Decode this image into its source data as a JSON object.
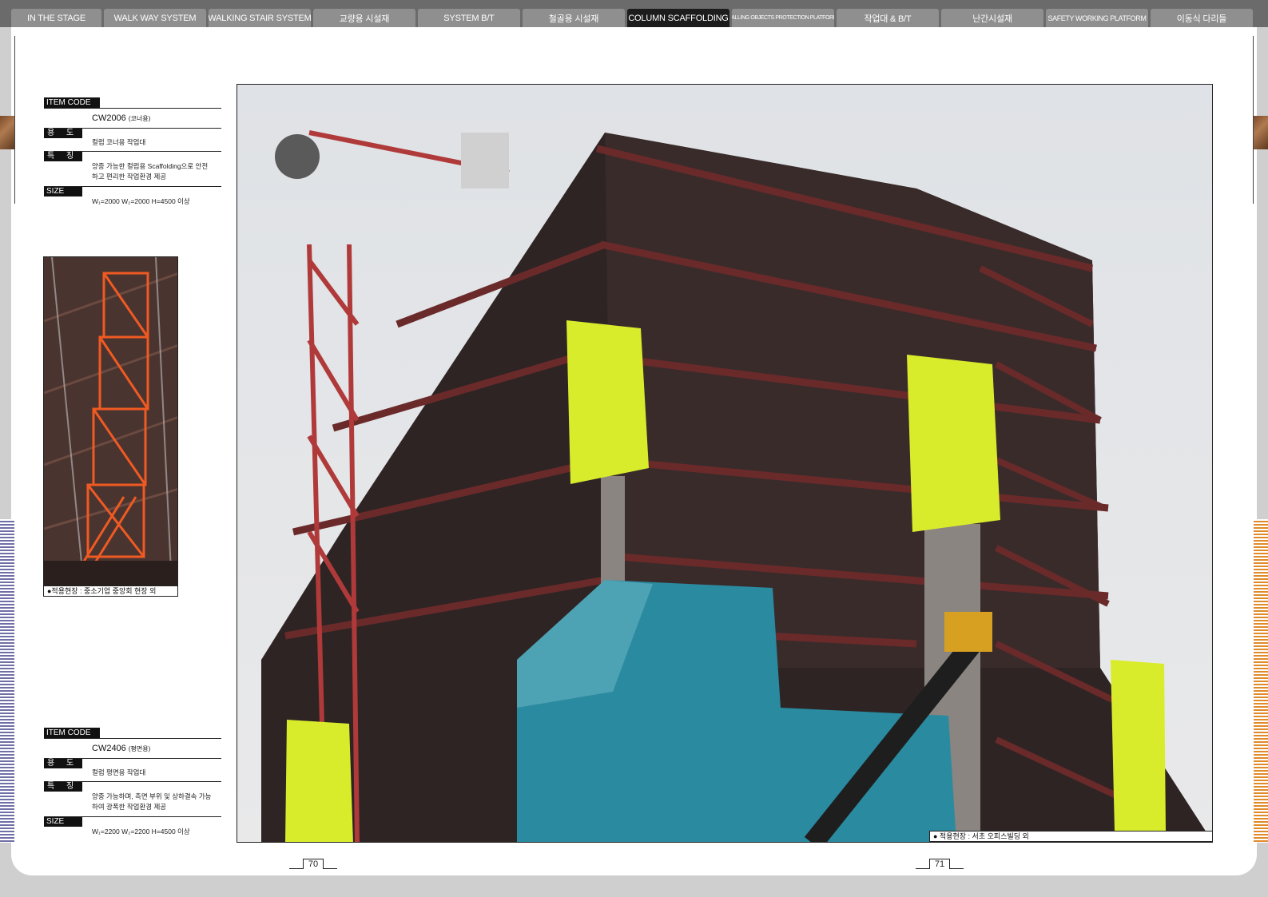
{
  "nav": {
    "tabs": [
      {
        "label": "IN THE STAGE",
        "active": false
      },
      {
        "label": "WALK WAY SYSTEM",
        "active": false
      },
      {
        "label": "WALKING STAIR SYSTEM",
        "active": false
      },
      {
        "label": "교량용 시설재",
        "active": false
      },
      {
        "label": "SYSTEM B/T",
        "active": false
      },
      {
        "label": "철골용 시설재",
        "active": false
      },
      {
        "label": "COLUMN SCAFFOLDING",
        "active": true
      },
      {
        "label": "FALLING OBJECTS PROTECTION PLATFORM",
        "active": false
      },
      {
        "label": "작업대 & B/T",
        "active": false
      },
      {
        "label": "난간시설재",
        "active": false
      },
      {
        "label": "SAFETY WORKING PLATFORM",
        "active": false
      },
      {
        "label": "이동식 다리들",
        "active": false
      }
    ]
  },
  "spec1": {
    "item_code_label": "ITEM CODE",
    "item_code": "CW2006",
    "item_code_note": "(코너용)",
    "use_label": "용 도",
    "use_text": "컬럼 코너용 작업대",
    "feature_label": "특 징",
    "feature_text_1": "양중 가능한 컬럼용 Scaffolding으로 안전",
    "feature_text_2": "하고 편리한 작업환경 제공",
    "size_label": "SIZE",
    "size_text": "W₁=2000  W₂=2000  H=4500 이상"
  },
  "spec2": {
    "item_code_label": "ITEM CODE",
    "item_code": "CW2406",
    "item_code_note": "(평면용)",
    "use_label": "용 도",
    "use_text": "컬럼 평면용 작업대",
    "feature_label": "특 징",
    "feature_text_1": "양중 가능하며, 측면 부위 및 상하결속 가능",
    "feature_text_2": "하여 광폭한 작업환경 제공",
    "size_label": "SIZE",
    "size_text": "W₁=2200  W₂=2200  H=4500 이상"
  },
  "photo_small": {
    "caption": "●적용현장 : 중소기업 중앙회 현장 외"
  },
  "photo_large": {
    "caption": "●  적용현장 : 서초 오피스빌딩 외"
  },
  "pages": {
    "left": "70",
    "right": "71"
  },
  "colors": {
    "nav_bg": "#6b6b6b",
    "tab": "#8f8f8f",
    "tab_active": "#1c1c1c",
    "stripe_left": "#6f6fa8",
    "stripe_right": "#e08a2a",
    "scaffold_yellow": "#d9ec2c",
    "net_blue": "#2a8aa0",
    "steel": "#5a2a2a"
  }
}
